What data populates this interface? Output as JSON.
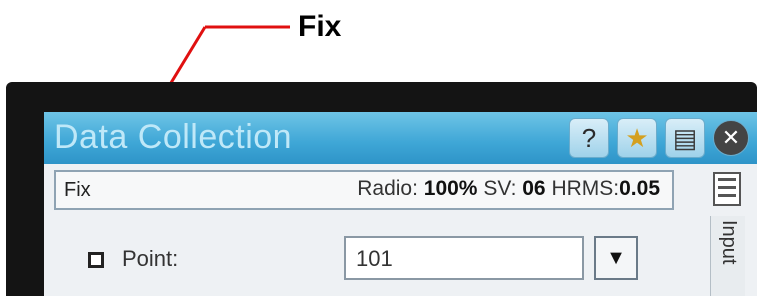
{
  "annotation": {
    "label": "Fix"
  },
  "window": {
    "title": "Data Collection",
    "icons": [
      "help-icon",
      "favorites-star-icon",
      "properties-icon",
      "close-icon"
    ]
  },
  "status": {
    "fix": "Fix",
    "radio_label": "Radio:",
    "radio_value": "100%",
    "sv_label": "SV:",
    "sv_value": "06",
    "hrms_label": "HRMS:",
    "hrms_value": "0.05"
  },
  "side": {
    "tab_label": "Input"
  },
  "form": {
    "point_label": "Point:",
    "point_value": "101"
  }
}
